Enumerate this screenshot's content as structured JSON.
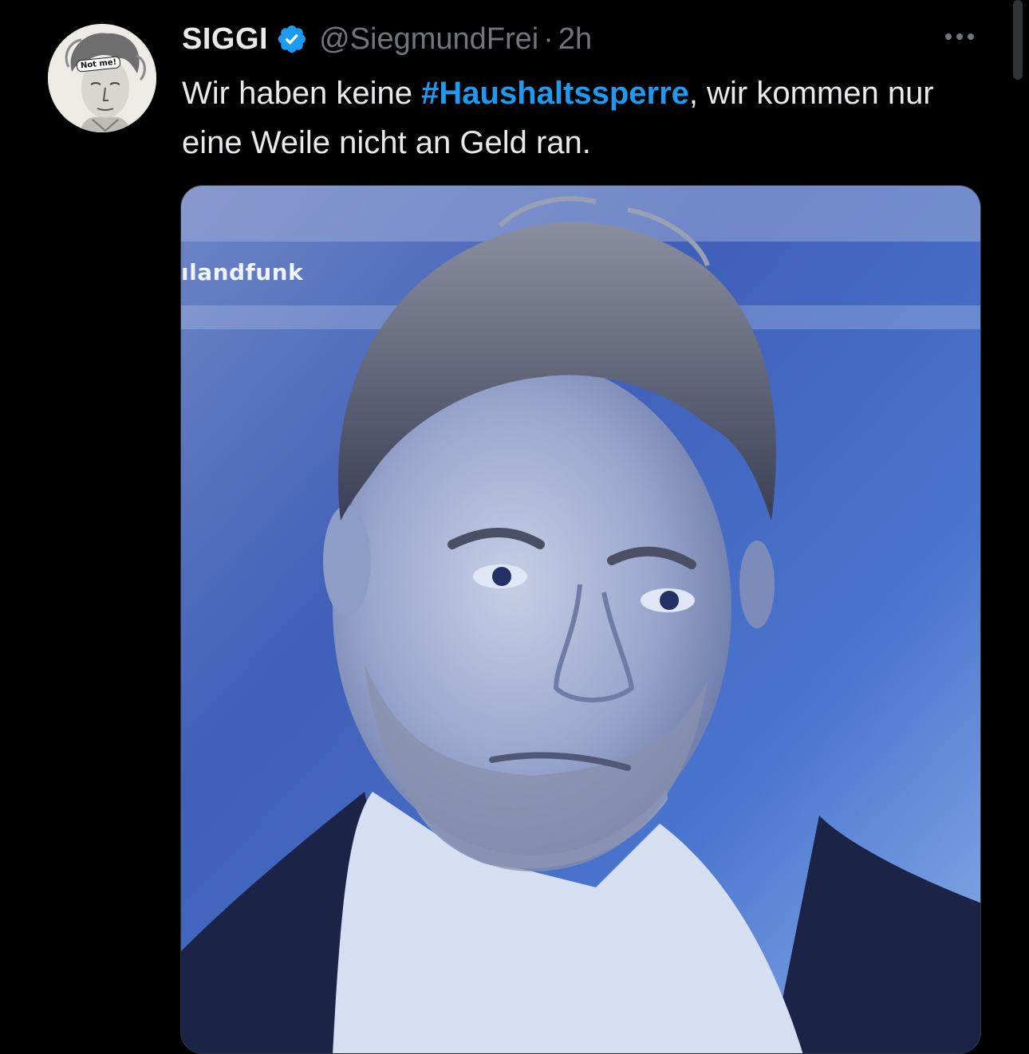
{
  "tweet": {
    "display_name": "SIGGI",
    "handle": "@SiegmundFrei",
    "separator": "·",
    "time": "2h",
    "text_before": "Wir haben keine ",
    "hashtag": "#Haushaltssperre",
    "text_after": ", wir kommen nur eine Weile nicht an Geld ran.",
    "avatar_caption": "Not me!",
    "media_watermark": "ılandfunk",
    "verified_icon": "verified-badge-icon",
    "more_icon": "more-dots-icon"
  },
  "colors": {
    "background": "#000000",
    "text": "#e7e9ea",
    "secondary": "#71767b",
    "accent": "#1d9bf0"
  }
}
